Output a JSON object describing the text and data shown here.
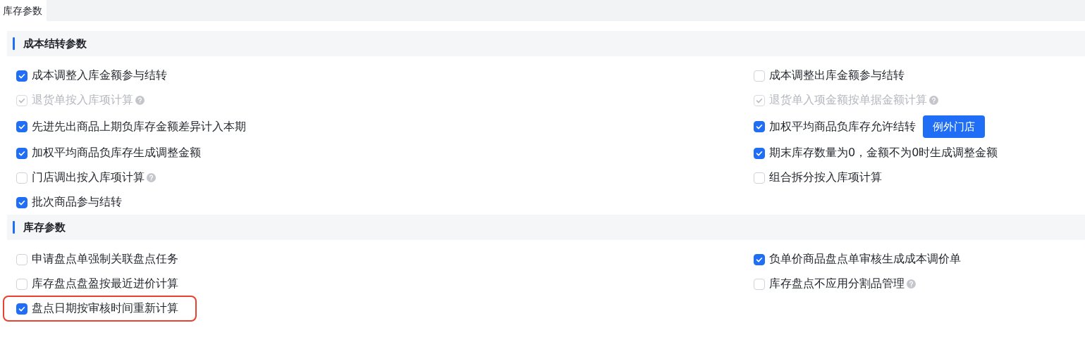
{
  "tabs": [
    {
      "label": "库存参数",
      "selected": true
    }
  ],
  "sections": [
    {
      "title": "成本结转参数",
      "rows": [
        {
          "left": {
            "label": "成本调整入库金额参与结转",
            "checked": true,
            "disabled": false
          },
          "right": {
            "label": "成本调整出库金额参与结转",
            "checked": false,
            "disabled": false
          }
        },
        {
          "left": {
            "label": "退货单按入库项计算",
            "checked": true,
            "disabled": true,
            "help": true
          },
          "right": {
            "label": "退货单入项金额按单据金额计算",
            "checked": true,
            "disabled": true,
            "help": true
          }
        },
        {
          "left": {
            "label": "先进先出商品上期负库存金额差异计入本期",
            "checked": true,
            "disabled": false
          },
          "right": {
            "label": "加权平均商品负库存允许结转",
            "checked": true,
            "disabled": false,
            "button": "例外门店"
          }
        },
        {
          "left": {
            "label": "加权平均商品负库存生成调整金额",
            "checked": true,
            "disabled": false
          },
          "right": {
            "label": "期末库存数量为0，金额不为0时生成调整金额",
            "checked": true,
            "disabled": false
          }
        },
        {
          "left": {
            "label": "门店调出按入库项计算",
            "checked": false,
            "disabled": false,
            "help": true
          },
          "right": {
            "label": "组合拆分按入库项计算",
            "checked": false,
            "disabled": false
          }
        },
        {
          "left": {
            "label": "批次商品参与结转",
            "checked": true,
            "disabled": false
          }
        }
      ]
    },
    {
      "title": "库存参数",
      "rows": [
        {
          "left": {
            "label": "申请盘点单强制关联盘点任务",
            "checked": false,
            "disabled": false
          },
          "right": {
            "label": "负单价商品盘点单审核生成成本调价单",
            "checked": true,
            "disabled": false
          }
        },
        {
          "left": {
            "label": "库存盘点盘盈按最近进价计算",
            "checked": false,
            "disabled": false
          },
          "right": {
            "label": "库存盘点不应用分割品管理",
            "checked": false,
            "disabled": false,
            "help": true
          }
        },
        {
          "left": {
            "label": "盘点日期按审核时间重新计算",
            "checked": true,
            "disabled": false,
            "highlighted": true
          }
        }
      ]
    }
  ]
}
